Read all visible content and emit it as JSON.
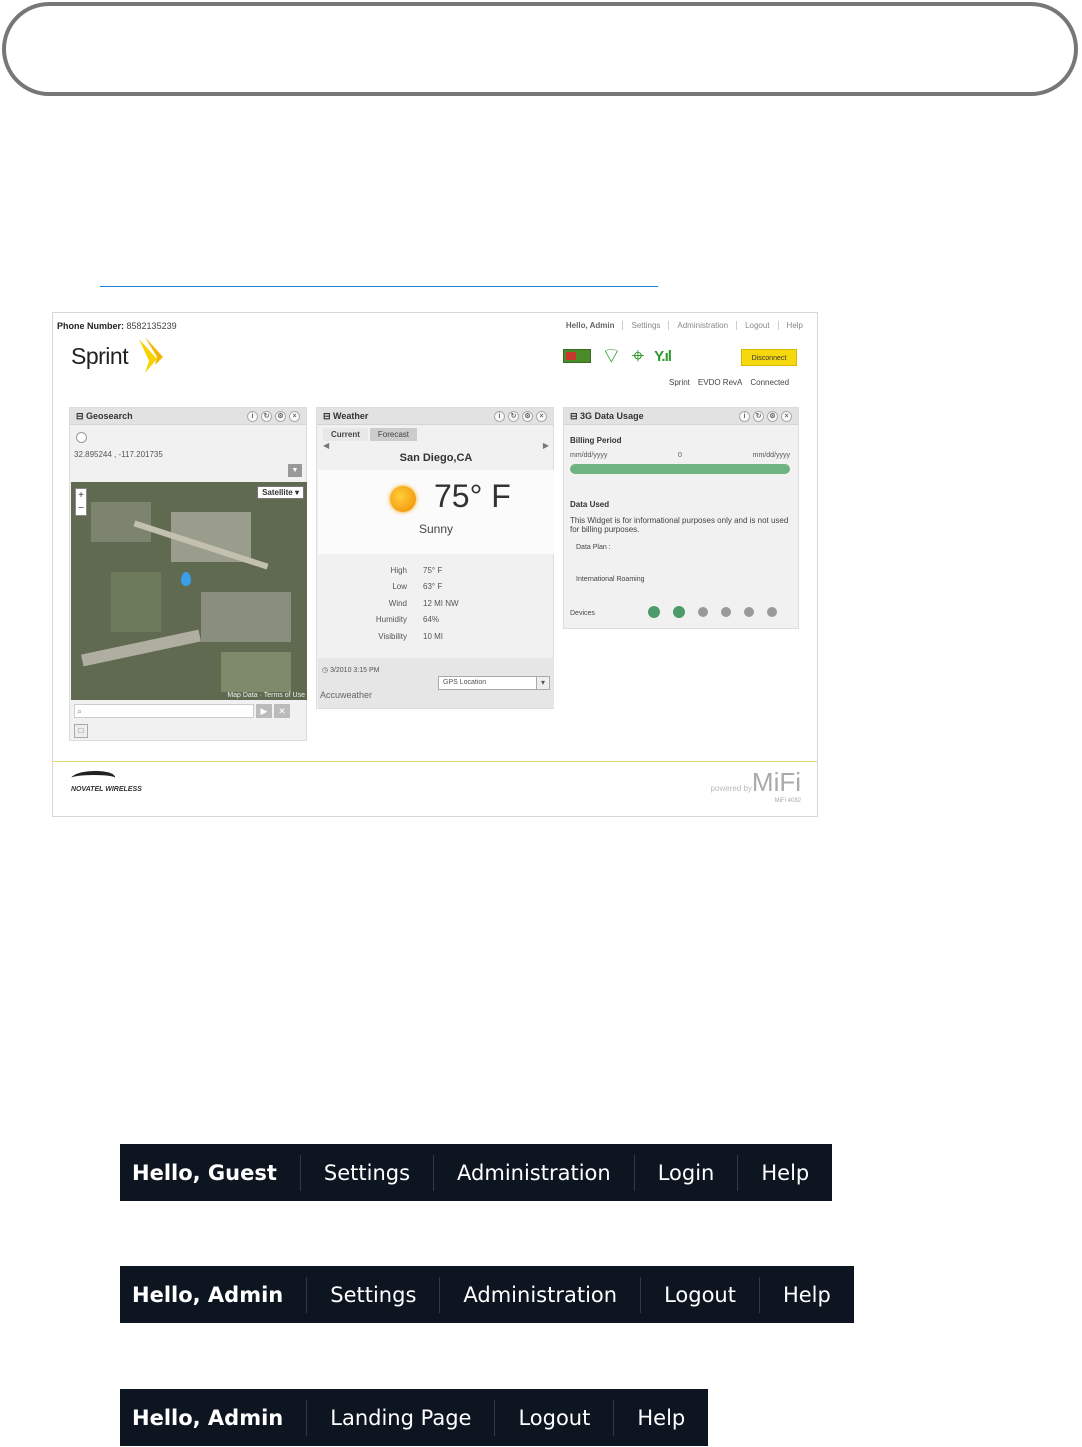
{
  "mifi_ui": {
    "phone_label": "Phone Number:",
    "phone_value": "8582135239",
    "top_nav": [
      "Hello, Admin",
      "Settings",
      "Administration",
      "Logout",
      "Help"
    ],
    "brand": "Sprint",
    "disconnect_label": "Disconnect",
    "status_labels": [
      "Sprint",
      "EVDO RevA",
      "Connected"
    ],
    "geosearch": {
      "title": "Geosearch",
      "coords": "32.895244 , -117.201735",
      "map_type": "Satellite",
      "map_credit": "Map Data · Terms of Use"
    },
    "weather": {
      "title": "Weather",
      "tabs": [
        "Current",
        "Forecast"
      ],
      "city": "San Diego,CA",
      "temp": "75° F",
      "condition": "Sunny",
      "rows": [
        {
          "k": "High",
          "v": "75° F"
        },
        {
          "k": "Low",
          "v": "63° F"
        },
        {
          "k": "Wind",
          "v": "12 MI NW"
        },
        {
          "k": "Humidity",
          "v": "64%"
        },
        {
          "k": "Visibility",
          "v": "10 MI"
        }
      ],
      "updated": "3/2010 3:15 PM",
      "provider": "Accuweather",
      "gps_select": "GPS Location"
    },
    "data_usage": {
      "title": "3G Data Usage",
      "billing_label": "Billing Period",
      "billing_start": "mm/dd/yyyy",
      "billing_mid": "0",
      "billing_end": "mm/dd/yyyy",
      "data_used_label": "Data Used",
      "note": "This Widget is for informational purposes only and is not used for billing purposes.",
      "data_plan_label": "Data Plan :",
      "roaming_label": "International Roaming",
      "devices_label": "Devices"
    },
    "footer": {
      "novatel": "NOVATEL WIRELESS",
      "powered": "powered by",
      "mifi": "MiFi",
      "model": "MiFi 4082"
    }
  },
  "navbar_guest": [
    "Hello, Guest",
    "Settings",
    "Administration",
    "Login",
    "Help"
  ],
  "navbar_admin": [
    "Hello, Admin",
    "Settings",
    "Administration",
    "Logout",
    "Help"
  ],
  "navbar_landing": [
    "Hello, Admin",
    "Landing Page",
    "Logout",
    "Help"
  ]
}
